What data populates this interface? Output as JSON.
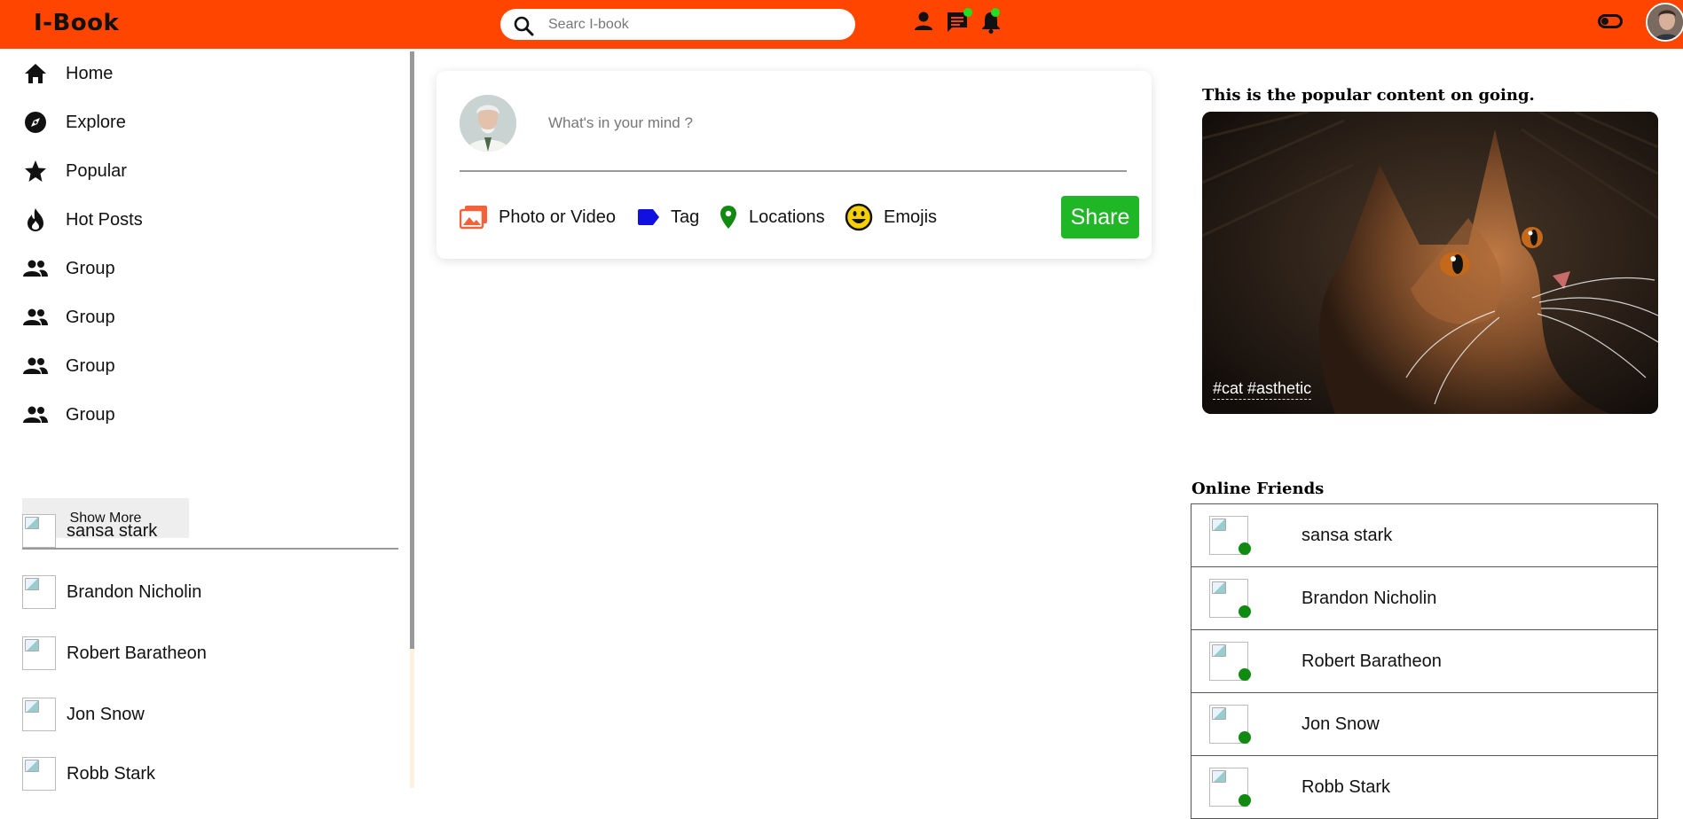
{
  "app": {
    "logo": "I-Book",
    "accent_color": "#ff4500",
    "search_placeholder": "Searc I-book"
  },
  "header": {
    "icons": [
      "person-icon",
      "chat-icon",
      "bell-icon",
      "theme-toggle-icon",
      "avatar"
    ],
    "notification_dot_color": "#22dd22"
  },
  "sidebar": {
    "nav": [
      {
        "label": "Home",
        "icon": "home-icon"
      },
      {
        "label": "Explore",
        "icon": "compass-icon"
      },
      {
        "label": "Popular",
        "icon": "star-icon"
      },
      {
        "label": "Hot Posts",
        "icon": "fire-icon"
      },
      {
        "label": "Group",
        "icon": "group-icon"
      },
      {
        "label": "Group",
        "icon": "group-icon"
      },
      {
        "label": "Group",
        "icon": "group-icon"
      },
      {
        "label": "Group",
        "icon": "group-icon"
      }
    ],
    "show_more_label": "Show More",
    "friends": [
      "sansa stark",
      "Brandon Nicholin",
      "Robert Baratheon",
      "Jon Snow",
      "Robb Stark"
    ]
  },
  "composer": {
    "placeholder": "What's in your mind ?",
    "options": [
      {
        "label": "Photo or Video",
        "icon": "photo-icon",
        "color": "#f4623a"
      },
      {
        "label": "Tag",
        "icon": "tag-icon",
        "color": "#1010e0"
      },
      {
        "label": "Locations",
        "icon": "location-pin-icon",
        "color": "#118a11"
      },
      {
        "label": "Emojis",
        "icon": "emoji-icon",
        "color": "#f5d000"
      }
    ],
    "share_label": "Share",
    "share_color": "#1fb726"
  },
  "popular": {
    "title": "This is the popular content on going.",
    "tags": "#cat #asthetic"
  },
  "online": {
    "title": "Online Friends",
    "friends": [
      "sansa stark",
      "Brandon Nicholin",
      "Robert Baratheon",
      "Jon Snow",
      "Robb Stark"
    ],
    "status_color": "#118a11"
  }
}
